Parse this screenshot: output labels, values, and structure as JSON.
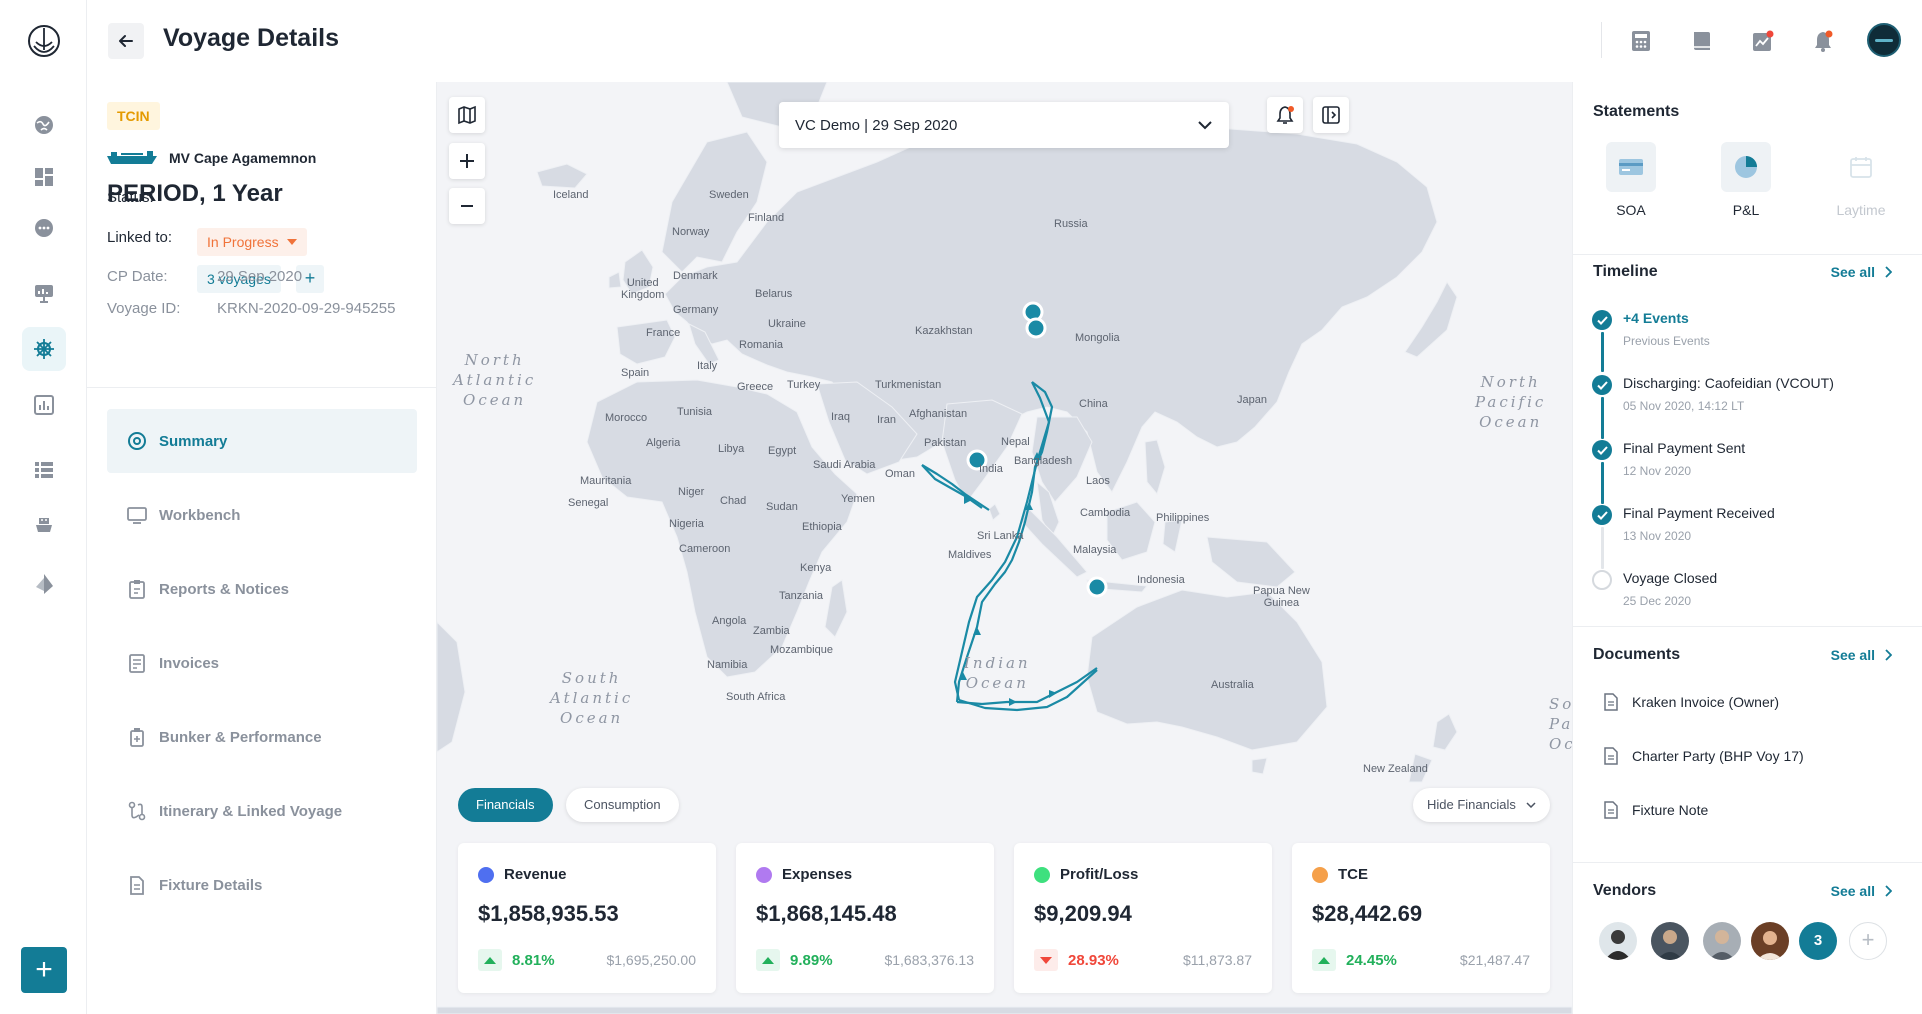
{
  "header": {
    "title": "Voyage Details"
  },
  "voyage": {
    "tag": "TCIN",
    "vessel": "MV Cape Agamemnon",
    "period": "PERIOD, 1 Year",
    "status_label": "Status:",
    "status_value": "In Progress",
    "linked_label": "Linked to:",
    "linked_value": "3 voyages",
    "linked_add": "+",
    "cp_label": "CP Date:",
    "cp_value": "29 Sep 2020",
    "id_label": "Voyage ID:",
    "id_value": "KRKN-2020-09-29-945255"
  },
  "nav": [
    {
      "label": "Summary",
      "icon": "target-icon"
    },
    {
      "label": "Workbench",
      "icon": "monitor-icon"
    },
    {
      "label": "Reports & Notices",
      "icon": "clipboard-icon"
    },
    {
      "label": "Invoices",
      "icon": "invoice-icon"
    },
    {
      "label": "Bunker & Performance",
      "icon": "fuel-icon"
    },
    {
      "label": "Itinerary & Linked Voyage",
      "icon": "route-icon"
    },
    {
      "label": "Fixture Details",
      "icon": "document-icon"
    }
  ],
  "map": {
    "voyage_select": "VC Demo | 29 Sep 2020",
    "labels": {
      "iceland": "Iceland",
      "sweden": "Sweden",
      "finland": "Finland",
      "norway": "Norway",
      "russia": "Russia",
      "uk": "United\nKingdom",
      "denmark": "Denmark",
      "belarus": "Belarus",
      "germany": "Germany",
      "ukraine": "Ukraine",
      "france": "France",
      "romania": "Romania",
      "kazakhstan": "Kazakhstan",
      "mongolia": "Mongolia",
      "spain": "Spain",
      "italy": "Italy",
      "greece": "Greece",
      "turkey": "Turkey",
      "turkmenistan": "Turkmenistan",
      "china": "China",
      "japan": "Japan",
      "morocco": "Morocco",
      "tunisia": "Tunisia",
      "iraq": "Iraq",
      "iran": "Iran",
      "afghanistan": "Afghanistan",
      "algeria": "Algeria",
      "libya": "Libya",
      "egypt": "Egypt",
      "pakistan": "Pakistan",
      "nepal": "Nepal",
      "saudi": "Saudi Arabia",
      "oman": "Oman",
      "india": "India",
      "bangladesh": "Bangladesh",
      "mauritania": "Mauritania",
      "niger": "Niger",
      "chad": "Chad",
      "sudan": "Sudan",
      "yemen": "Yemen",
      "laos": "Laos",
      "senegal": "Senegal",
      "nigeria": "Nigeria",
      "ethiopia": "Ethiopia",
      "cambodia": "Cambodia",
      "philippines": "Philippines",
      "srilanka": "Sri Lanka",
      "maldives": "Maldives",
      "cameroon": "Cameroon",
      "malaysia": "Malaysia",
      "kenya": "Kenya",
      "indonesia": "Indonesia",
      "png": "Papua New\nGuinea",
      "tanzania": "Tanzania",
      "angola": "Angola",
      "zambia": "Zambia",
      "mozambique": "Mozambique",
      "namibia": "Namibia",
      "southafrica": "South Africa",
      "australia": "Australia",
      "newzealand": "New Zealand"
    },
    "oceans": {
      "north_atlantic": "North\nAtlantic\nOcean",
      "north_pacific": "North\nPacific\nOcean",
      "south_atlantic": "South\nAtlantic\nOcean",
      "indian": "Indian\nOcean",
      "south_pacific_partial": "So\nPa\nOc"
    },
    "toggle_financials": "Financials",
    "toggle_consumption": "Consumption",
    "hide_financials": "Hide Financials"
  },
  "financials": [
    {
      "label": "Revenue",
      "color": "#4f6ff0",
      "value": "$1,858,935.53",
      "change": "8.81%",
      "direction": "up",
      "previous": "$1,695,250.00"
    },
    {
      "label": "Expenses",
      "color": "#b07af0",
      "value": "$1,868,145.48",
      "change": "9.89%",
      "direction": "up",
      "previous": "$1,683,376.13"
    },
    {
      "label": "Profit/Loss",
      "color": "#3ee07e",
      "value": "$9,209.94",
      "change": "28.93%",
      "direction": "down",
      "previous": "$11,873.87"
    },
    {
      "label": "TCE",
      "color": "#f5a04a",
      "value": "$28,442.69",
      "change": "24.45%",
      "direction": "up",
      "previous": "$21,487.47"
    }
  ],
  "statements": {
    "title": "Statements",
    "items": [
      {
        "label": "SOA",
        "icon": "card-icon"
      },
      {
        "label": "P&L",
        "icon": "pie-chart-icon"
      },
      {
        "label": "Laytime",
        "icon": "calendar-icon"
      }
    ]
  },
  "timeline": {
    "title": "Timeline",
    "see_all": "See all",
    "events": [
      {
        "title": "+4 Events",
        "sub": "Previous Events",
        "done": true
      },
      {
        "title": "Discharging: Caofeidian (VCOUT)",
        "sub": "05 Nov 2020, 14:12 LT",
        "done": true
      },
      {
        "title": "Final Payment Sent",
        "sub": "12 Nov 2020",
        "done": true
      },
      {
        "title": "Final Payment Received",
        "sub": "13 Nov 2020",
        "done": true
      },
      {
        "title": "Voyage Closed",
        "sub": "25 Dec 2020",
        "done": false
      }
    ]
  },
  "documents": {
    "title": "Documents",
    "see_all": "See all",
    "items": [
      "Kraken Invoice (Owner)",
      "Charter Party (BHP Voy 17)",
      "Fixture Note"
    ]
  },
  "vendors": {
    "title": "Vendors",
    "see_all": "See all",
    "more_count": "3",
    "add": "+"
  },
  "colors": {
    "accent": "#137c96",
    "route": "#1a8aa5",
    "status_orange": "#f0733a",
    "tag_amber": "#e49a00"
  }
}
